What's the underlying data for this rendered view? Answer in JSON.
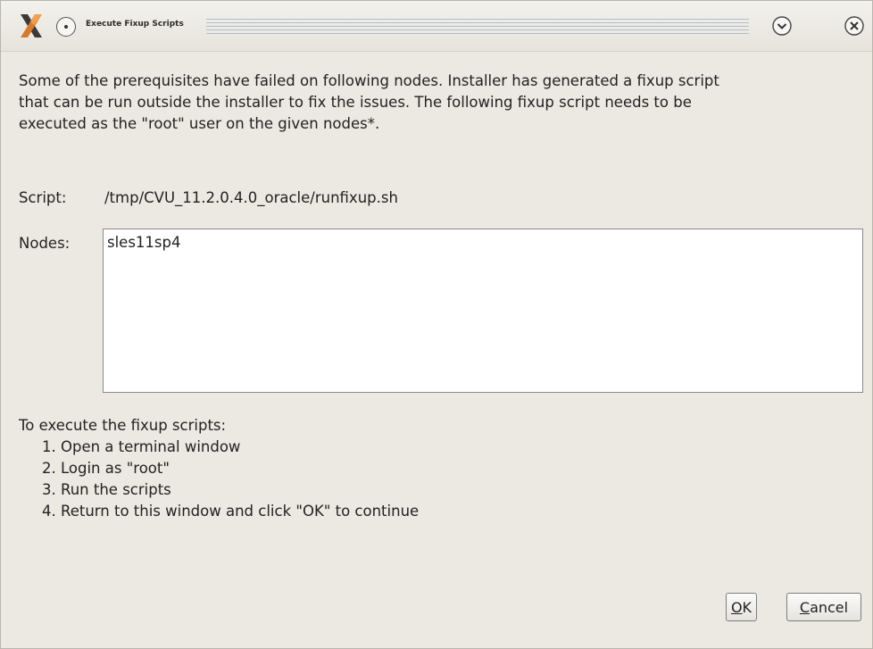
{
  "window": {
    "title": "Execute Fixup Scripts"
  },
  "icons": {
    "app": "x-logo-icon",
    "menu": "window-menu-icon",
    "minimize": "chevron-down-circle-icon",
    "close": "close-circle-icon"
  },
  "message": {
    "line1": "Some of the prerequisites have failed on following nodes. Installer has generated a fixup script",
    "line2": "that can be run outside the installer to fix the issues. The following fixup script needs to be",
    "line3": "executed as the \"root\" user on the given nodes*."
  },
  "script": {
    "label": "Script:",
    "value": "/tmp/CVU_11.2.0.4.0_oracle/runfixup.sh"
  },
  "nodes": {
    "label": "Nodes:",
    "value": "sles11sp4"
  },
  "instructions": {
    "title": "To execute the fixup scripts:",
    "steps": [
      "1. Open a terminal window",
      "2. Login as \"root\"",
      "3. Run the scripts",
      "4. Return to this window and click \"OK\" to continue"
    ]
  },
  "buttons": {
    "ok": {
      "mnemonic": "O",
      "rest": "K"
    },
    "cancel": {
      "mnemonic": "C",
      "rest": "ancel"
    }
  },
  "colors": {
    "background": "#ece9e2",
    "title_stripes": "#a8b4c8"
  }
}
